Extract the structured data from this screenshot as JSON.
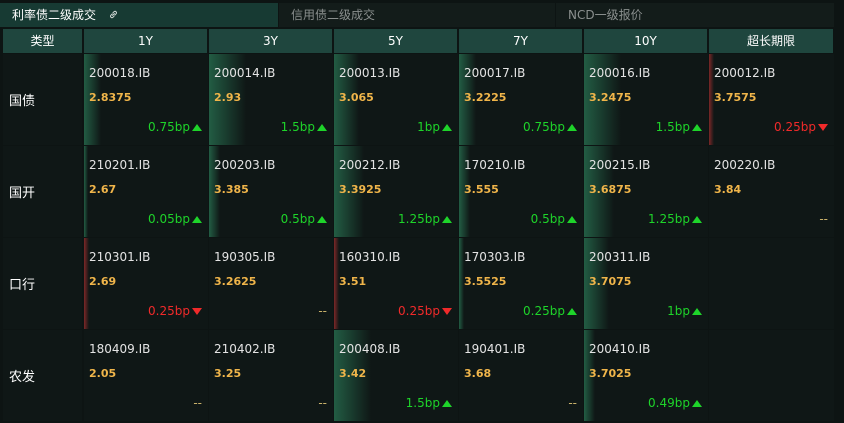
{
  "tabs": [
    {
      "label": "利率债二级成交",
      "active": true
    },
    {
      "label": "信用债二级成交",
      "active": false
    },
    {
      "label": "NCD一级报价",
      "active": false
    }
  ],
  "headers": [
    "类型",
    "1Y",
    "3Y",
    "5Y",
    "7Y",
    "10Y",
    "超长期限"
  ],
  "rows": [
    {
      "label": "国债",
      "cells": [
        {
          "code": "200018.IB",
          "yield": "2.8375",
          "change": "0.75bp",
          "dir": "up",
          "bar": "g",
          "barPct": 0.14
        },
        {
          "code": "200014.IB",
          "yield": "2.93",
          "change": "1.5bp",
          "dir": "up",
          "bar": "g",
          "barPct": 0.3
        },
        {
          "code": "200013.IB",
          "yield": "3.065",
          "change": "1bp",
          "dir": "up",
          "bar": "g",
          "barPct": 0.2
        },
        {
          "code": "200017.IB",
          "yield": "3.2225",
          "change": "0.75bp",
          "dir": "up",
          "bar": "g",
          "barPct": 0.14
        },
        {
          "code": "200016.IB",
          "yield": "3.2475",
          "change": "1.5bp",
          "dir": "up",
          "bar": "g",
          "barPct": 0.3
        },
        {
          "code": "200012.IB",
          "yield": "3.7575",
          "change": "0.25bp",
          "dir": "down",
          "bar": "r",
          "barPct": 0.04
        }
      ]
    },
    {
      "label": "国开",
      "cells": [
        {
          "code": "210201.IB",
          "yield": "2.67",
          "change": "0.05bp",
          "dir": "up",
          "bar": "g",
          "barPct": 0.03
        },
        {
          "code": "200203.IB",
          "yield": "3.385",
          "change": "0.5bp",
          "dir": "up",
          "bar": "g",
          "barPct": 0.09
        },
        {
          "code": "200212.IB",
          "yield": "3.3925",
          "change": "1.25bp",
          "dir": "up",
          "bar": "g",
          "barPct": 0.24
        },
        {
          "code": "170210.IB",
          "yield": "3.555",
          "change": "0.5bp",
          "dir": "up",
          "bar": "g",
          "barPct": 0.09
        },
        {
          "code": "200215.IB",
          "yield": "3.6875",
          "change": "1.25bp",
          "dir": "up",
          "bar": "g",
          "barPct": 0.24
        },
        {
          "code": "200220.IB",
          "yield": "3.84",
          "change": "--",
          "dir": "none",
          "bar": "",
          "barPct": 0
        }
      ]
    },
    {
      "label": "口行",
      "cells": [
        {
          "code": "210301.IB",
          "yield": "2.69",
          "change": "0.25bp",
          "dir": "down",
          "bar": "r",
          "barPct": 0.04
        },
        {
          "code": "190305.IB",
          "yield": "3.2625",
          "change": "--",
          "dir": "none",
          "bar": "",
          "barPct": 0
        },
        {
          "code": "160310.IB",
          "yield": "3.51",
          "change": "0.25bp",
          "dir": "down",
          "bar": "r",
          "barPct": 0.04
        },
        {
          "code": "170303.IB",
          "yield": "3.5525",
          "change": "0.25bp",
          "dir": "up",
          "bar": "g",
          "barPct": 0.04
        },
        {
          "code": "200311.IB",
          "yield": "3.7075",
          "change": "1bp",
          "dir": "up",
          "bar": "g",
          "barPct": 0.2
        },
        null
      ]
    },
    {
      "label": "农发",
      "cells": [
        {
          "code": "180409.IB",
          "yield": "2.05",
          "change": "--",
          "dir": "none",
          "bar": "",
          "barPct": 0
        },
        {
          "code": "210402.IB",
          "yield": "3.25",
          "change": "--",
          "dir": "none",
          "bar": "",
          "barPct": 0
        },
        {
          "code": "200408.IB",
          "yield": "3.42",
          "change": "1.5bp",
          "dir": "up",
          "bar": "g",
          "barPct": 0.3
        },
        {
          "code": "190401.IB",
          "yield": "3.68",
          "change": "--",
          "dir": "none",
          "bar": "",
          "barPct": 0
        },
        {
          "code": "200410.IB",
          "yield": "3.7025",
          "change": "0.49bp",
          "dir": "up",
          "bar": "g",
          "barPct": 0.09
        },
        null
      ]
    }
  ]
}
